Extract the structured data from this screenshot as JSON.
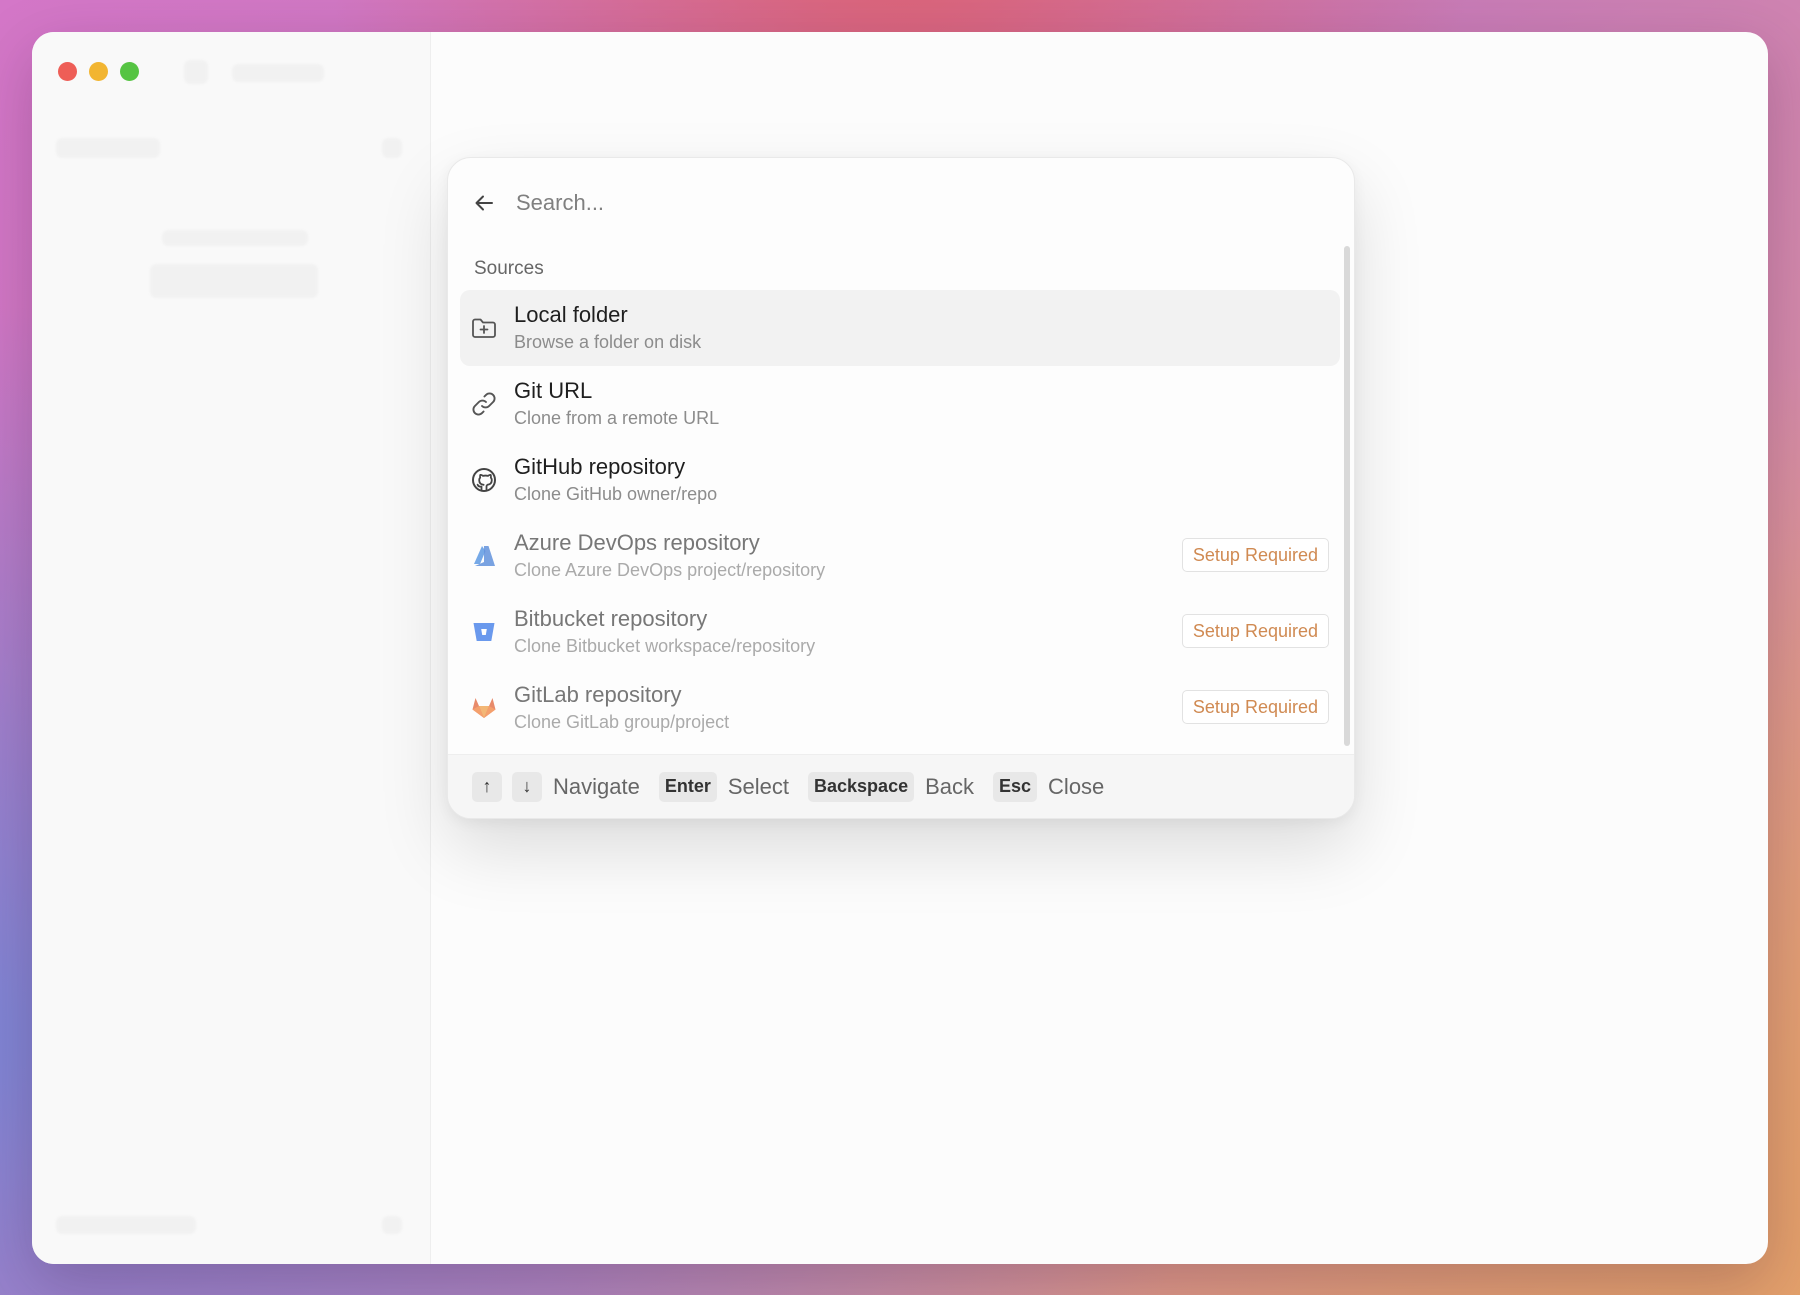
{
  "palette": {
    "search_placeholder": "Search...",
    "section_title": "Sources",
    "items": [
      {
        "title": "Local folder",
        "subtitle": "Browse a folder on disk",
        "icon": "folder-plus-icon",
        "badge": ""
      },
      {
        "title": "Git URL",
        "subtitle": "Clone from a remote URL",
        "icon": "link-icon",
        "badge": ""
      },
      {
        "title": "GitHub repository",
        "subtitle": "Clone GitHub owner/repo",
        "icon": "github-icon",
        "badge": ""
      },
      {
        "title": "Azure DevOps repository",
        "subtitle": "Clone Azure DevOps project/repository",
        "icon": "azure-devops-icon",
        "badge": "Setup Required"
      },
      {
        "title": "Bitbucket repository",
        "subtitle": "Clone Bitbucket workspace/repository",
        "icon": "bitbucket-icon",
        "badge": "Setup Required"
      },
      {
        "title": "GitLab repository",
        "subtitle": "Clone GitLab group/project",
        "icon": "gitlab-icon",
        "badge": "Setup Required"
      }
    ],
    "footer": {
      "up_key": "↑",
      "down_key": "↓",
      "navigate_label": "Navigate",
      "enter_key": "Enter",
      "select_label": "Select",
      "backspace_key": "Backspace",
      "back_label": "Back",
      "esc_key": "Esc",
      "close_label": "Close"
    }
  },
  "colors": {
    "badge_text": "#d08a52",
    "azure": "#4a8ee0",
    "bitbucket": "#3a78e8",
    "gitlab_orange": "#e2643a"
  }
}
